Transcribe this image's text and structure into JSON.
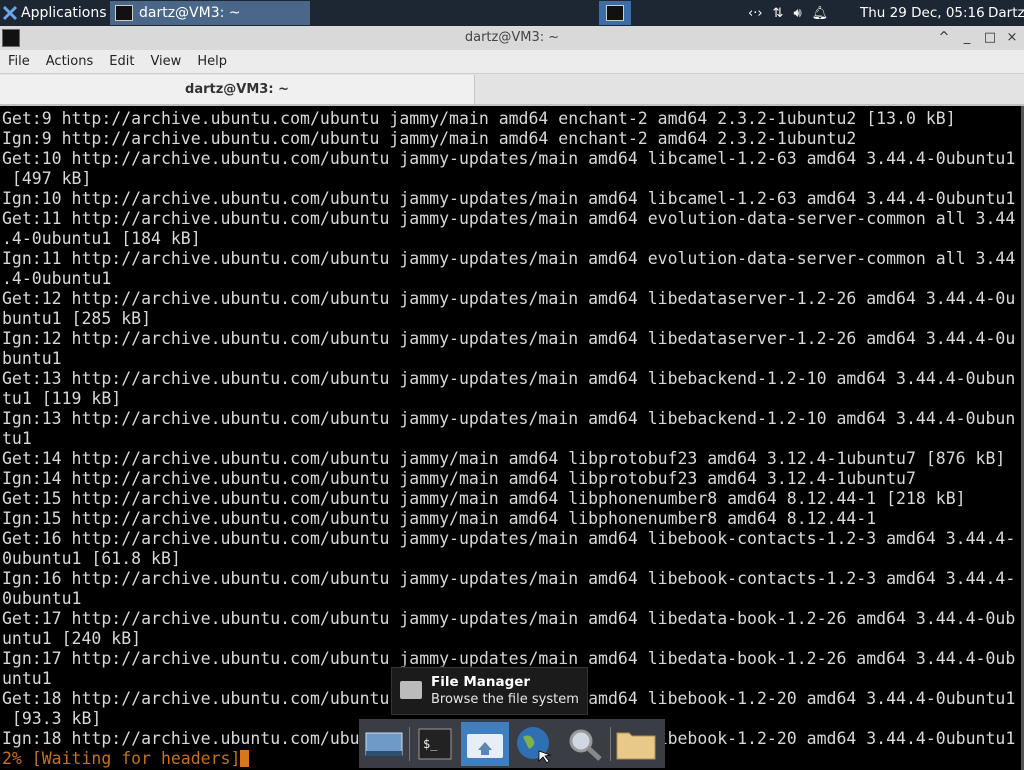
{
  "panel": {
    "apps_label": "Applications",
    "task_label": "dartz@VM3: ~",
    "clock": "Thu 29 Dec, 05:16",
    "user": "Dartz",
    "tray": [
      "network-arrows-icon",
      "updown-arrows-icon",
      "volume-icon",
      "notification-bell-icon"
    ]
  },
  "window": {
    "title": "dartz@VM3: ~",
    "tab_label": "dartz@VM3: ~",
    "buttons": [
      "^",
      "_",
      "□",
      "×"
    ]
  },
  "menu": {
    "file": "File",
    "actions": "Actions",
    "edit": "Edit",
    "view": "View",
    "help": "Help"
  },
  "terminal": {
    "lines": [
      "Get:9 http://archive.ubuntu.com/ubuntu jammy/main amd64 enchant-2 amd64 2.3.2-1ubuntu2 [13.0 kB]",
      "Ign:9 http://archive.ubuntu.com/ubuntu jammy/main amd64 enchant-2 amd64 2.3.2-1ubuntu2",
      "Get:10 http://archive.ubuntu.com/ubuntu jammy-updates/main amd64 libcamel-1.2-63 amd64 3.44.4-0ubuntu1",
      " [497 kB]",
      "Ign:10 http://archive.ubuntu.com/ubuntu jammy-updates/main amd64 libcamel-1.2-63 amd64 3.44.4-0ubuntu1",
      "Get:11 http://archive.ubuntu.com/ubuntu jammy-updates/main amd64 evolution-data-server-common all 3.44",
      ".4-0ubuntu1 [184 kB]",
      "Ign:11 http://archive.ubuntu.com/ubuntu jammy-updates/main amd64 evolution-data-server-common all 3.44",
      ".4-0ubuntu1",
      "Get:12 http://archive.ubuntu.com/ubuntu jammy-updates/main amd64 libedataserver-1.2-26 amd64 3.44.4-0u",
      "buntu1 [285 kB]",
      "Ign:12 http://archive.ubuntu.com/ubuntu jammy-updates/main amd64 libedataserver-1.2-26 amd64 3.44.4-0u",
      "buntu1",
      "Get:13 http://archive.ubuntu.com/ubuntu jammy-updates/main amd64 libebackend-1.2-10 amd64 3.44.4-0ubun",
      "tu1 [119 kB]",
      "Ign:13 http://archive.ubuntu.com/ubuntu jammy-updates/main amd64 libebackend-1.2-10 amd64 3.44.4-0ubun",
      "tu1",
      "Get:14 http://archive.ubuntu.com/ubuntu jammy/main amd64 libprotobuf23 amd64 3.12.4-1ubuntu7 [876 kB]",
      "Ign:14 http://archive.ubuntu.com/ubuntu jammy/main amd64 libprotobuf23 amd64 3.12.4-1ubuntu7",
      "Get:15 http://archive.ubuntu.com/ubuntu jammy/main amd64 libphonenumber8 amd64 8.12.44-1 [218 kB]",
      "Ign:15 http://archive.ubuntu.com/ubuntu jammy/main amd64 libphonenumber8 amd64 8.12.44-1",
      "Get:16 http://archive.ubuntu.com/ubuntu jammy-updates/main amd64 libebook-contacts-1.2-3 amd64 3.44.4-",
      "0ubuntu1 [61.8 kB]",
      "Ign:16 http://archive.ubuntu.com/ubuntu jammy-updates/main amd64 libebook-contacts-1.2-3 amd64 3.44.4-",
      "0ubuntu1",
      "Get:17 http://archive.ubuntu.com/ubuntu jammy-updates/main amd64 libedata-book-1.2-26 amd64 3.44.4-0ub",
      "untu1 [240 kB]",
      "Ign:17 http://archive.ubuntu.com/ubuntu jammy-updates/main amd64 libedata-book-1.2-26 amd64 3.44.4-0ub",
      "untu1",
      "Get:18 http://archive.ubuntu.com/ubuntu jammy-updates/main amd64 libebook-1.2-20 amd64 3.44.4-0ubuntu1",
      " [93.3 kB]",
      "Ign:18 http://archive.ubuntu.com/ubuntu jammy-updates/main amd64 libebook-1.2-20 amd64 3.44.4-0ubuntu1"
    ],
    "prompt": "2% [Waiting for headers]"
  },
  "tooltip": {
    "title": "File Manager",
    "subtitle": "Browse the file system"
  },
  "dock": {
    "items": [
      "show-desktop-icon",
      "terminal-icon",
      "home-folder-icon",
      "web-browser-icon",
      "search-icon",
      "folder-icon"
    ]
  },
  "colors": {
    "panel_bg": "#1d2734",
    "terminal_bg": "#000000",
    "terminal_fg": "#d8d8d8",
    "prompt_fg": "#c4711a",
    "dock_active": "#3f7fbf"
  }
}
